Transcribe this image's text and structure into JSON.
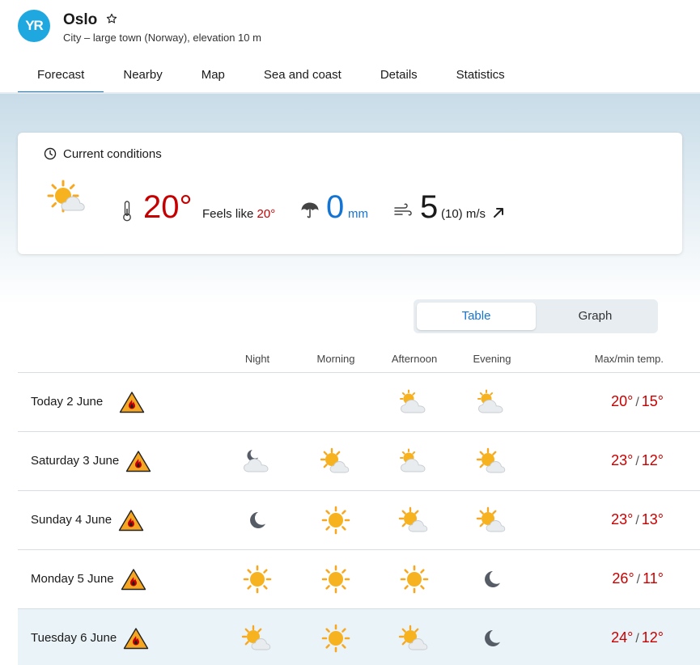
{
  "header": {
    "logo": "YR",
    "city": "Oslo",
    "subtitle": "City – large town (Norway), elevation 10 m"
  },
  "tabs": [
    {
      "label": "Forecast",
      "active": true
    },
    {
      "label": "Nearby"
    },
    {
      "label": "Map"
    },
    {
      "label": "Sea and coast"
    },
    {
      "label": "Details"
    },
    {
      "label": "Statistics"
    }
  ],
  "current": {
    "title": "Current conditions",
    "temperature": "20°",
    "feels_label": "Feels like",
    "feels_value": "20°",
    "precipitation": "0",
    "precip_unit": "mm",
    "wind": "5",
    "gust": "(10) m/s",
    "icon": "partly-cloudy-sun-icon"
  },
  "toggle": {
    "table": "Table",
    "graph": "Graph"
  },
  "table": {
    "headers": {
      "night": "Night",
      "morning": "Morning",
      "afternoon": "Afternoon",
      "evening": "Evening",
      "maxmin": "Max/min temp."
    },
    "rows": [
      {
        "day": "Today 2 June",
        "night": "",
        "morning": "",
        "afternoon": "cloudy-sun",
        "evening": "cloudy-sun",
        "max": "20°",
        "min": "15°"
      },
      {
        "day": "Saturday 3 June",
        "night": "cloudy-moon",
        "morning": "partly-cloudy-sun",
        "afternoon": "cloudy-sun",
        "evening": "partly-cloudy-sun",
        "max": "23°",
        "min": "12°"
      },
      {
        "day": "Sunday 4 June",
        "night": "moon",
        "morning": "sun",
        "afternoon": "partly-cloudy-sun",
        "evening": "partly-cloudy-sun",
        "max": "23°",
        "min": "13°"
      },
      {
        "day": "Monday 5 June",
        "night": "sun",
        "morning": "sun",
        "afternoon": "sun",
        "evening": "moon",
        "max": "26°",
        "min": "11°"
      },
      {
        "day": "Tuesday 6 June",
        "night": "partly-cloudy-sun",
        "morning": "sun",
        "afternoon": "partly-cloudy-sun",
        "evening": "moon",
        "max": "24°",
        "min": "12°"
      }
    ]
  },
  "colors": {
    "accent": "#1474d4",
    "temp_red": "#c60000",
    "sun": "#f7a823",
    "warning": "#f5a623"
  }
}
